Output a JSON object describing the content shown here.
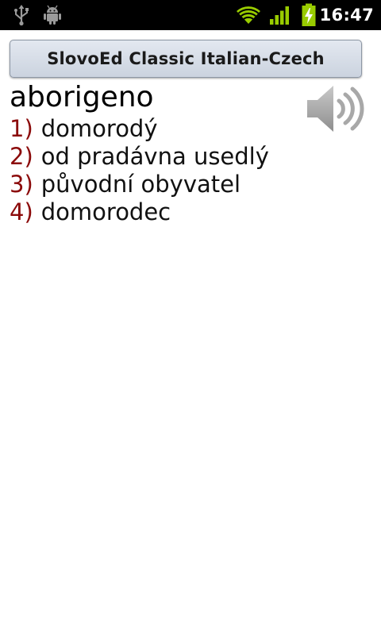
{
  "status_bar": {
    "time": "16:47",
    "icons": [
      "usb-icon",
      "android-debug-icon",
      "wifi-icon",
      "signal-icon",
      "battery-charging-icon"
    ],
    "accent_color": "#99cc00"
  },
  "app": {
    "title": "SlovoEd Classic Italian-Czech"
  },
  "entry": {
    "headword": "aborigeno",
    "senses": [
      {
        "num": "1)",
        "text": "domorodý"
      },
      {
        "num": "2)",
        "text": "od pradávna usedlý"
      },
      {
        "num": "3)",
        "text": "původní obyvatel"
      },
      {
        "num": "4)",
        "text": "domorodec"
      }
    ],
    "sense_number_color": "#8b0a0a"
  }
}
